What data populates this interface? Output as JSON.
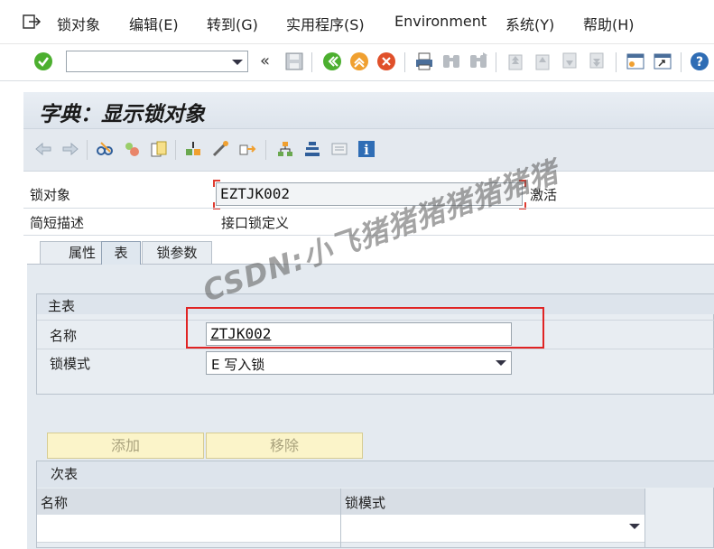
{
  "menu": {
    "items": [
      "锁对象",
      "编辑(E)",
      "转到(G)",
      "实用程序(S)",
      "Environment",
      "系统(Y)",
      "帮助(H)"
    ]
  },
  "system_toolbar": {
    "command_field_value": "",
    "icons": [
      "enter-icon",
      "save-icon",
      "back-icon",
      "exit-icon",
      "cancel-icon",
      "print-icon",
      "find-icon",
      "find-next-icon",
      "first-page-icon",
      "previous-page-icon",
      "next-page-icon",
      "last-page-icon",
      "new-session-icon",
      "shortcut-icon",
      "help-icon"
    ]
  },
  "title": "字典：显示锁对象",
  "header": {
    "lock_object_label": "锁对象",
    "lock_object_value": "EZTJK002",
    "status": "激活",
    "short_desc_label": "简短描述",
    "short_desc_value": "接口锁定义"
  },
  "tabs": [
    {
      "label": "属性",
      "active": false
    },
    {
      "label": "表",
      "active": true
    },
    {
      "label": "锁参数",
      "active": false
    }
  ],
  "primary_table": {
    "group_title": "主表",
    "name_label": "名称",
    "name_value": "ZTJK002",
    "lock_mode_label": "锁模式",
    "lock_mode_value": "E 写入锁"
  },
  "buttons": {
    "add": "添加",
    "remove": "移除"
  },
  "secondary_tables": {
    "group_title": "次表",
    "columns": [
      "名称",
      "锁模式"
    ]
  },
  "watermark": "CSDN:小飞猪猪猪猪猪猪猪",
  "colors": {
    "highlight": "#e02424",
    "title_bg": "#e9eef4",
    "button_bg": "#fbf4c9"
  }
}
